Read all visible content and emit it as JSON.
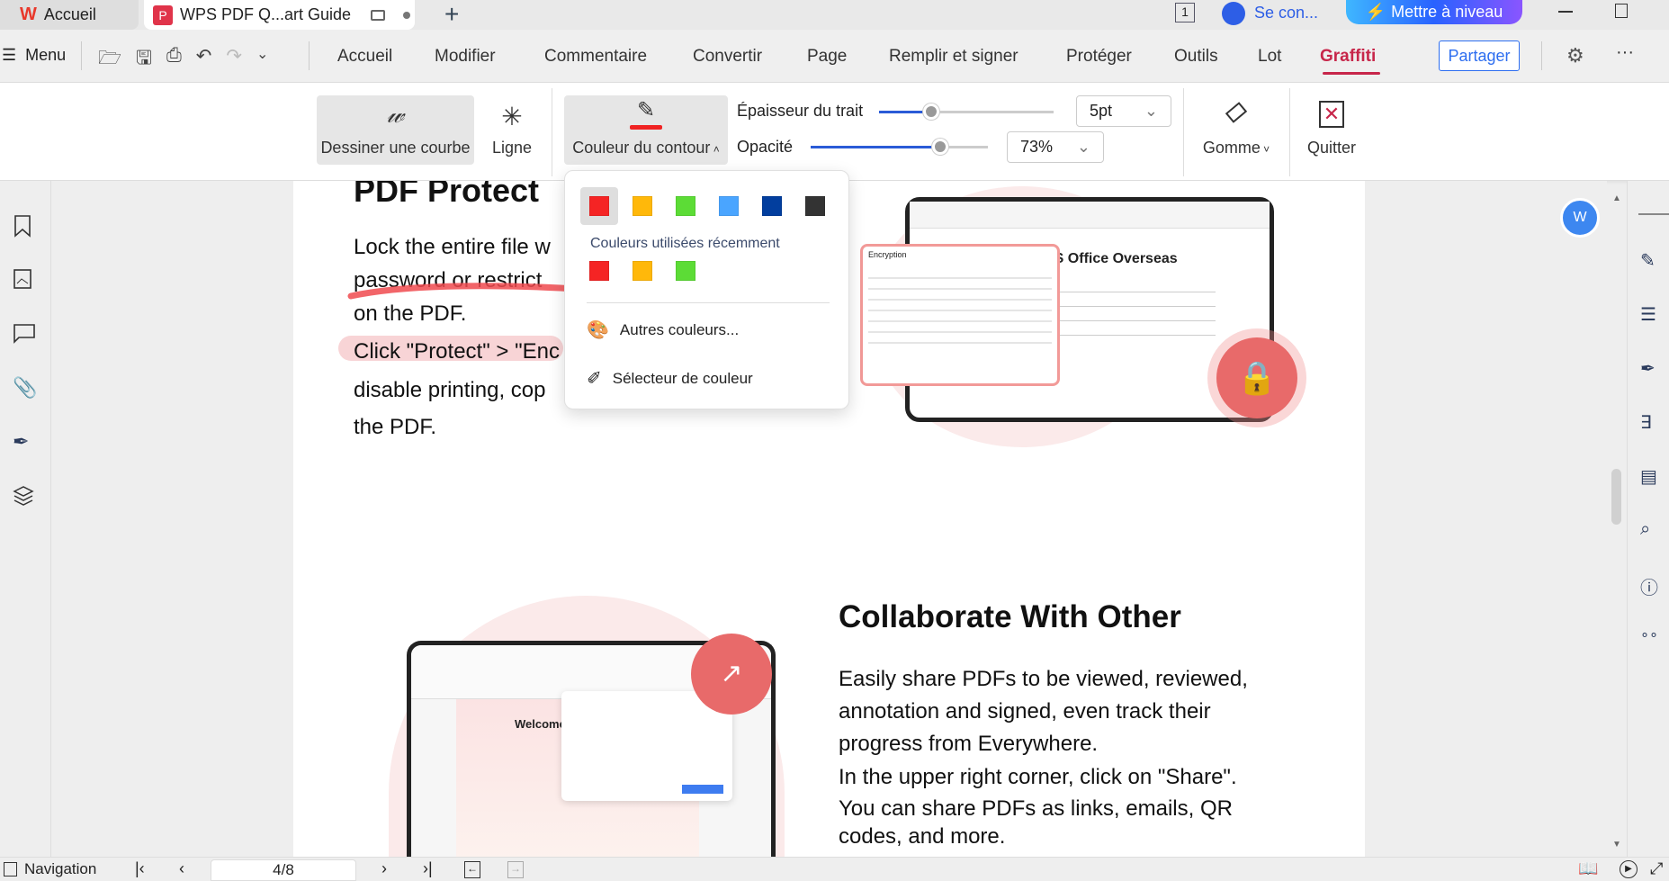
{
  "tabs": {
    "home": "Accueil",
    "document": "WPS PDF Q...art Guide"
  },
  "account": {
    "badge": "1",
    "signin": "Se con...",
    "upgrade": "Mettre à niveau"
  },
  "menubar": {
    "menu": "Menu",
    "tabs": [
      "Accueil",
      "Modifier",
      "Commentaire",
      "Convertir",
      "Page",
      "Remplir et signer",
      "Protéger",
      "Outils",
      "Lot",
      "Graffiti"
    ],
    "active_tab": "Graffiti",
    "share": "Partager"
  },
  "ribbon": {
    "draw_curve": "Dessiner une courbe",
    "line": "Ligne",
    "stroke_color": "Couleur du contour",
    "thickness_label": "Épaisseur du trait",
    "thickness_value": "5pt",
    "thickness_fraction": 0.3,
    "opacity_label": "Opacité",
    "opacity_value": "73%",
    "opacity_fraction": 0.73,
    "eraser": "Gomme",
    "quit": "Quitter",
    "current_color": "#f02323"
  },
  "color_popup": {
    "palette": [
      "#f52424",
      "#ffb80a",
      "#5cdc36",
      "#4aa5ff",
      "#023e9e",
      "#333333"
    ],
    "recent_label": "Couleurs utilisées récemment",
    "recent": [
      "#f52424",
      "#ffb80a",
      "#5cdc36"
    ],
    "more_colors": "Autres couleurs...",
    "picker": "Sélecteur de couleur"
  },
  "document": {
    "section1_title": "PDF Protect",
    "section1_lines": [
      "Lock the entire file w",
      "password or restrict",
      "on the PDF.",
      "Click \"Protect\" > \"Enc",
      "disable printing, cop",
      " the PDF."
    ],
    "image1_dialog": "Encryption",
    "image1_heading": "PS Office Overseas",
    "section2_title": "Collaborate With Other",
    "section2_lines": [
      "Easily share PDFs to be viewed, reviewed,",
      "annotation and signed, even track their",
      "progress from Everywhere.",
      "In the upper right corner, click on \"Share\".",
      "You can share PDFs as links, emails, QR",
      "codes, and more."
    ],
    "image2_heading": "Welcome to"
  },
  "statusbar": {
    "navigation": "Navigation",
    "page": "4/8"
  }
}
